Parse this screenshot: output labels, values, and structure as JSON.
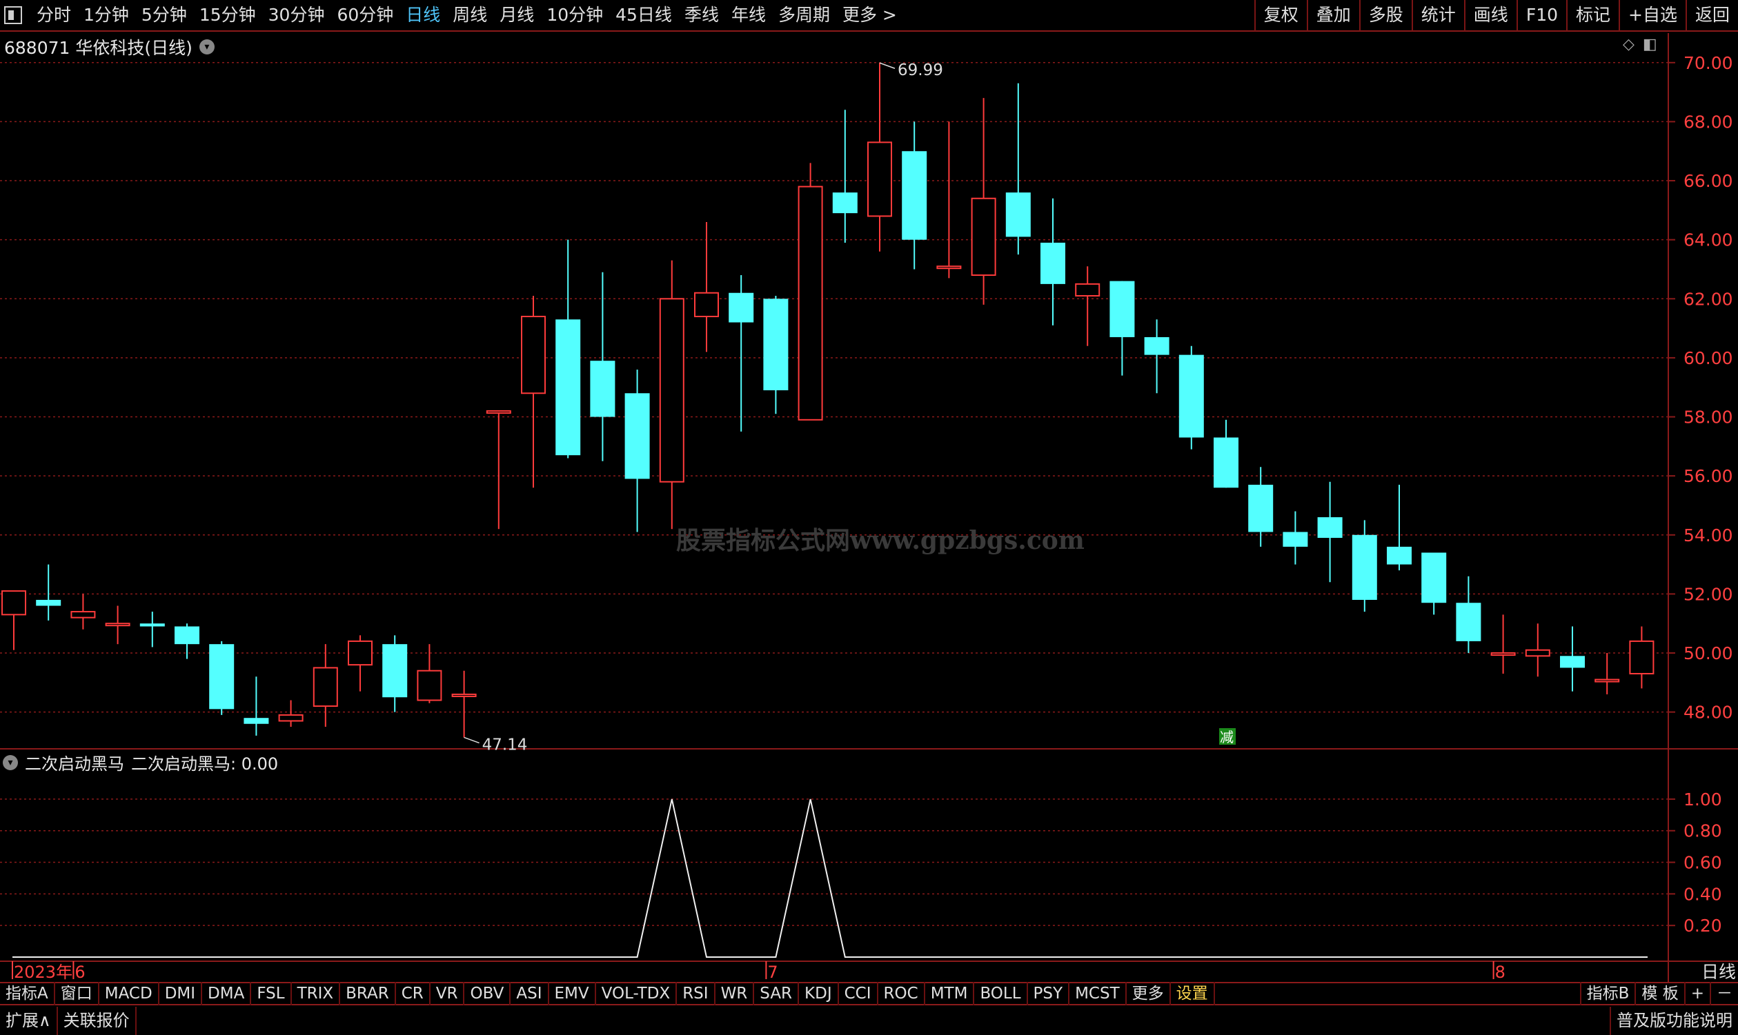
{
  "topbar": {
    "periods": [
      "分时",
      "1分钟",
      "5分钟",
      "15分钟",
      "30分钟",
      "60分钟",
      "日线",
      "周线",
      "月线",
      "10分钟",
      "45日线",
      "季线",
      "年线",
      "多周期",
      "更多 >"
    ],
    "active_period": "日线",
    "right_buttons": [
      "复权",
      "叠加",
      "多股",
      "统计",
      "画线",
      "F10",
      "标记",
      "+自选",
      "返回"
    ]
  },
  "stock": {
    "title": "688071 华依科技(日线)"
  },
  "watermark": "股票指标公式网www.gpzbgs.com",
  "colors": {
    "up": "#ff3b3b",
    "down": "#54ffff",
    "grid": "#8b1a1a",
    "axis_text": "#ff4040",
    "tag_bg": "#1b8a1b"
  },
  "chart_data": [
    {
      "type": "candlestick",
      "ylim": [
        46.8,
        71.0
      ],
      "y_ticks": [
        "70.00",
        "68.00",
        "66.00",
        "64.00",
        "62.00",
        "60.00",
        "58.00",
        "56.00",
        "54.00",
        "52.00",
        "50.00",
        "48.00"
      ],
      "x_labels": [
        {
          "label": "2023年",
          "index": 0
        },
        {
          "label": "6",
          "index": 2
        },
        {
          "label": "7",
          "index": 22
        },
        {
          "label": "8",
          "index": 43
        }
      ],
      "annotations": {
        "high": "69.99",
        "low": "47.14",
        "tag": "减",
        "tag_index": 35
      },
      "candles": [
        {
          "o": 51.3,
          "c": 52.1,
          "h": 52.1,
          "l": 50.1
        },
        {
          "o": 51.8,
          "c": 51.6,
          "h": 53.0,
          "l": 51.1
        },
        {
          "o": 51.2,
          "c": 51.4,
          "h": 52.0,
          "l": 50.8
        },
        {
          "o": 51.0,
          "c": 51.0,
          "h": 51.6,
          "l": 50.3
        },
        {
          "o": 51.0,
          "c": 50.9,
          "h": 51.4,
          "l": 50.2
        },
        {
          "o": 50.9,
          "c": 50.3,
          "h": 51.0,
          "l": 49.8
        },
        {
          "o": 50.3,
          "c": 48.1,
          "h": 50.4,
          "l": 47.9
        },
        {
          "o": 47.8,
          "c": 47.6,
          "h": 49.2,
          "l": 47.2
        },
        {
          "o": 47.7,
          "c": 47.9,
          "h": 48.4,
          "l": 47.5
        },
        {
          "o": 48.2,
          "c": 49.5,
          "h": 50.3,
          "l": 47.5
        },
        {
          "o": 49.6,
          "c": 50.4,
          "h": 50.6,
          "l": 48.7
        },
        {
          "o": 50.3,
          "c": 48.5,
          "h": 50.6,
          "l": 48.0
        },
        {
          "o": 48.4,
          "c": 49.4,
          "h": 50.3,
          "l": 48.3
        },
        {
          "o": 48.6,
          "c": 48.6,
          "h": 49.4,
          "l": 47.14
        },
        {
          "o": 58.2,
          "c": 58.2,
          "h": 58.2,
          "l": 54.2
        },
        {
          "o": 58.8,
          "c": 61.4,
          "h": 62.1,
          "l": 55.6
        },
        {
          "o": 61.3,
          "c": 56.7,
          "h": 64.0,
          "l": 56.6
        },
        {
          "o": 59.9,
          "c": 58.0,
          "h": 62.9,
          "l": 56.5
        },
        {
          "o": 58.8,
          "c": 55.9,
          "h": 59.6,
          "l": 54.1
        },
        {
          "o": 55.8,
          "c": 62.0,
          "h": 63.3,
          "l": 54.2
        },
        {
          "o": 61.4,
          "c": 62.2,
          "h": 64.6,
          "l": 60.2
        },
        {
          "o": 62.2,
          "c": 61.2,
          "h": 62.8,
          "l": 57.5
        },
        {
          "o": 62.0,
          "c": 58.9,
          "h": 62.1,
          "l": 58.1
        },
        {
          "o": 57.9,
          "c": 65.8,
          "h": 66.6,
          "l": 57.9
        },
        {
          "o": 65.6,
          "c": 64.9,
          "h": 68.4,
          "l": 63.9
        },
        {
          "o": 64.8,
          "c": 67.3,
          "h": 69.99,
          "l": 63.6
        },
        {
          "o": 67.0,
          "c": 64.0,
          "h": 68.0,
          "l": 63.0
        },
        {
          "o": 63.1,
          "c": 63.1,
          "h": 68.0,
          "l": 62.7
        },
        {
          "o": 62.8,
          "c": 65.4,
          "h": 68.8,
          "l": 61.8
        },
        {
          "o": 65.6,
          "c": 64.1,
          "h": 69.3,
          "l": 63.5
        },
        {
          "o": 63.9,
          "c": 62.5,
          "h": 65.4,
          "l": 61.1
        },
        {
          "o": 62.1,
          "c": 62.5,
          "h": 63.1,
          "l": 60.4
        },
        {
          "o": 62.6,
          "c": 60.7,
          "h": 62.6,
          "l": 59.4
        },
        {
          "o": 60.7,
          "c": 60.1,
          "h": 61.3,
          "l": 58.8
        },
        {
          "o": 60.1,
          "c": 57.3,
          "h": 60.4,
          "l": 56.9
        },
        {
          "o": 57.3,
          "c": 55.6,
          "h": 57.9,
          "l": 55.6
        },
        {
          "o": 55.7,
          "c": 54.1,
          "h": 56.3,
          "l": 53.6
        },
        {
          "o": 54.1,
          "c": 53.6,
          "h": 54.8,
          "l": 53.0
        },
        {
          "o": 54.6,
          "c": 53.9,
          "h": 55.8,
          "l": 52.4
        },
        {
          "o": 54.0,
          "c": 51.8,
          "h": 54.5,
          "l": 51.4
        },
        {
          "o": 53.6,
          "c": 53.0,
          "h": 55.7,
          "l": 52.8
        },
        {
          "o": 53.4,
          "c": 51.7,
          "h": 53.4,
          "l": 51.3
        },
        {
          "o": 51.7,
          "c": 50.4,
          "h": 52.6,
          "l": 50.0
        },
        {
          "o": 50.0,
          "c": 50.0,
          "h": 51.3,
          "l": 49.3
        },
        {
          "o": 49.9,
          "c": 50.1,
          "h": 51.0,
          "l": 49.2
        },
        {
          "o": 49.9,
          "c": 49.5,
          "h": 50.9,
          "l": 48.7
        },
        {
          "o": 49.1,
          "c": 49.1,
          "h": 50.0,
          "l": 48.6
        },
        {
          "o": 49.3,
          "c": 50.4,
          "h": 50.9,
          "l": 48.8
        }
      ]
    },
    {
      "type": "line",
      "name": "二次启动黑马",
      "ylim": [
        0,
        1.1
      ],
      "y_ticks": [
        "1.00",
        "0.80",
        "0.60",
        "0.40",
        "0.20"
      ],
      "values": [
        0,
        0,
        0,
        0,
        0,
        0,
        0,
        0,
        0,
        0,
        0,
        0,
        0,
        0,
        0,
        0,
        0,
        0,
        0,
        1,
        0,
        0,
        0,
        1,
        0,
        0,
        0,
        0,
        0,
        0,
        0,
        0,
        0,
        0,
        0,
        0,
        0,
        0,
        0,
        0,
        0,
        0,
        0,
        0,
        0,
        0,
        0,
        0
      ]
    }
  ],
  "indicator": {
    "label": "二次启动黑马",
    "value_text": "二次启动黑马: 0.00"
  },
  "tabs": [
    "指标A",
    "窗口",
    "MACD",
    "DMI",
    "DMA",
    "FSL",
    "TRIX",
    "BRAR",
    "CR",
    "VR",
    "OBV",
    "ASI",
    "EMV",
    "VOL-TDX",
    "RSI",
    "WR",
    "SAR",
    "KDJ",
    "CCI",
    "ROC",
    "MTM",
    "BOLL",
    "PSY",
    "MCST",
    "更多",
    "设置"
  ],
  "tabs_right": [
    "指标B",
    "模 板",
    "+",
    "－"
  ],
  "status": {
    "expand": "扩展∧",
    "related": "关联报价",
    "right": "普及版功能说明",
    "period_label": "日线"
  }
}
